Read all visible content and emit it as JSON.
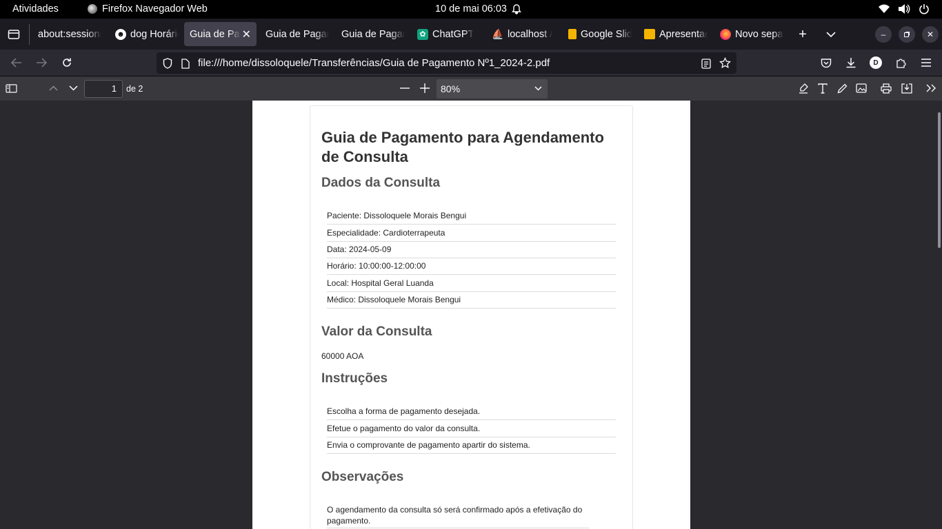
{
  "system_bar": {
    "activities": "Atividades",
    "app_name": "Firefox Navegador Web",
    "clock": "10 de mai  06:03"
  },
  "tabs": [
    {
      "label": "about:sessionrestore",
      "icon": "puzzle-icon"
    },
    {
      "label": "dog Horário",
      "icon": "alien-icon"
    },
    {
      "label": "Guia de Pagamento",
      "icon": "",
      "active": true
    },
    {
      "label": "Guia de Pagamento",
      "icon": ""
    },
    {
      "label": "Guia de Pagamento",
      "icon": ""
    },
    {
      "label": "ChatGPT",
      "icon": "chatgpt-icon"
    },
    {
      "label": "localhost / ",
      "icon": "phpmyadmin-icon"
    },
    {
      "label": "Google Slides",
      "icon": "google-slides-icon"
    },
    {
      "label": "Apresentação",
      "icon": "slides-icon"
    },
    {
      "label": "Novo separador",
      "icon": "firefox-icon"
    }
  ],
  "address_bar": {
    "url": "file:///home/dissoloquele/Transferências/Guia de Pagamento Nº1_2024-2.pdf"
  },
  "account_initial": "D",
  "pdf_toolbar": {
    "page_number": "1",
    "page_count": "de 2",
    "zoom": "80%"
  },
  "document": {
    "title": "Guia de Pagamento para Agendamento de Consulta",
    "section_dados": "Dados da Consulta",
    "dados_rows": [
      "Paciente: Dissoloquele Morais Bengui",
      "Especialidade: Cardioterrapeuta",
      "Data: 2024-05-09",
      "Horário: 10:00:00-12:00:00",
      "Local: Hospital Geral Luanda",
      "Médico: Dissoloquele Morais Bengui"
    ],
    "section_valor": "Valor da Consulta",
    "valor": "60000 AOA",
    "section_instrucoes": "Instruções",
    "instrucoes_rows": [
      "Escolha a forma de pagamento desejada.",
      "Efetue o pagamento do valor da consulta.",
      "Envia o comprovante de pagamento apartir do sistema."
    ],
    "section_observacoes": "Observações",
    "observacao": "O agendamento da consulta só será confirmado após a efetivação do pagamento."
  },
  "colors": {
    "tab_bg": "#1c1b22",
    "nav_bg": "#2b2a33",
    "pdf_toolbar_bg": "#38383d",
    "viewer_bg": "#2a2a2e",
    "active_tab": "#42414d"
  }
}
